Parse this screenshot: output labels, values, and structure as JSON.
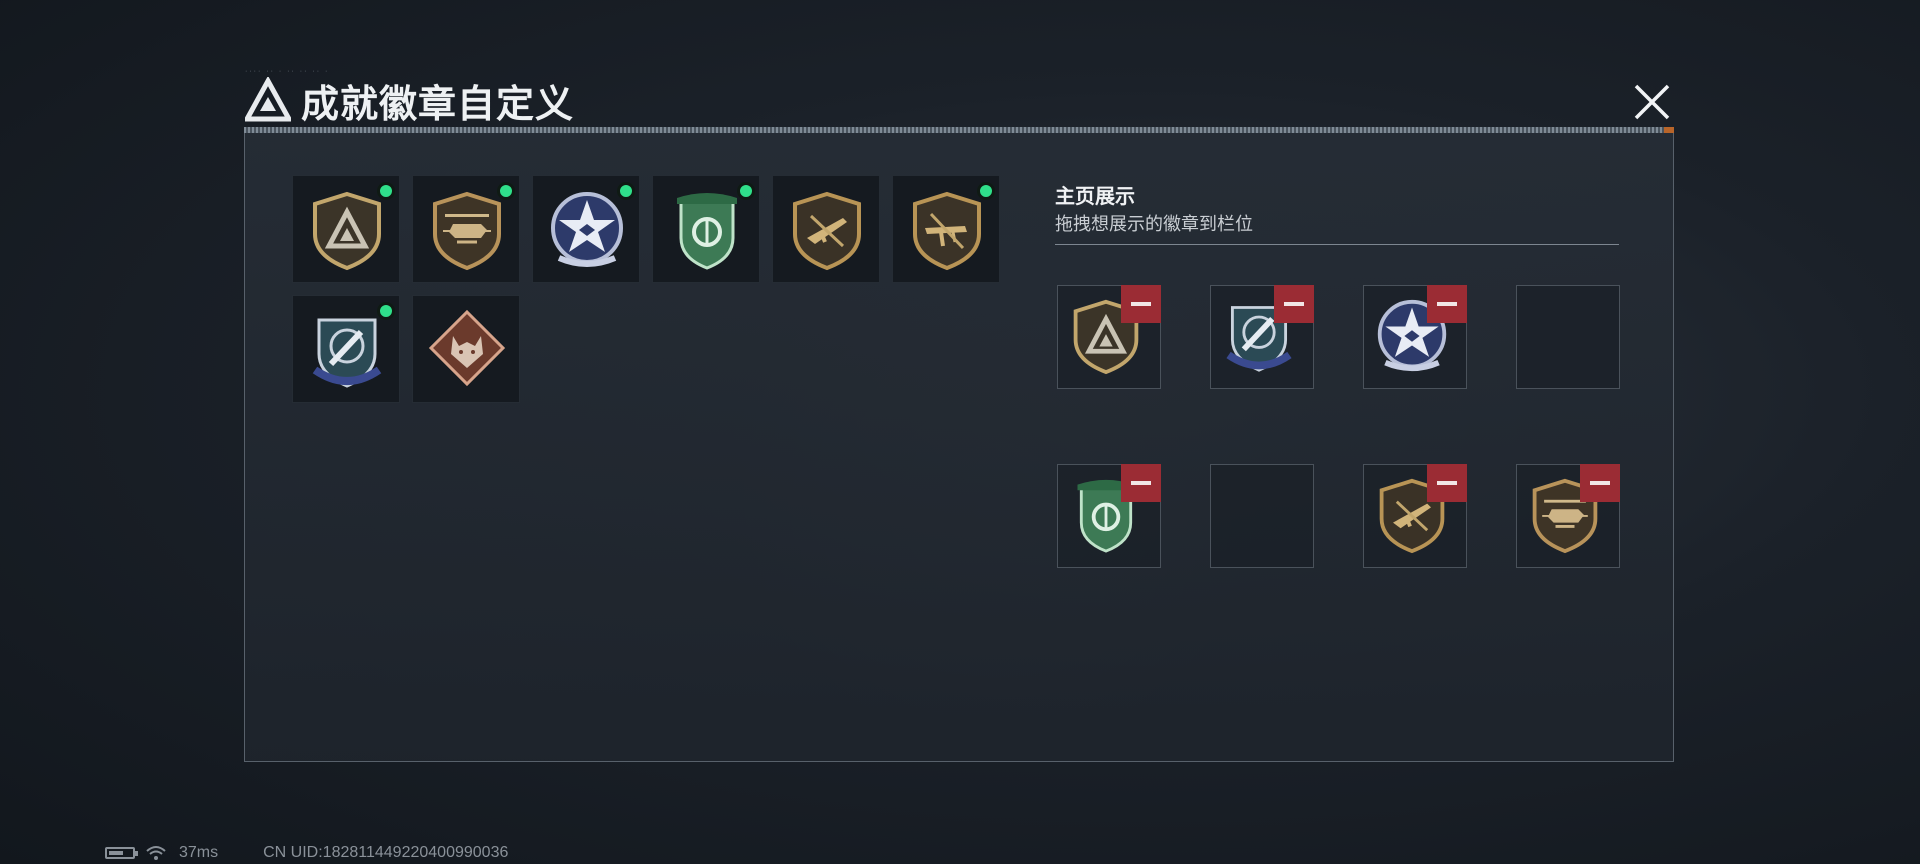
{
  "header": {
    "title": "成就徽章自定义",
    "deco_text": "···· ·· · ·· ·· ·· ·"
  },
  "showcase": {
    "title": "主页展示",
    "subtitle": "拖拽想展示的徽章到栏位"
  },
  "badges": [
    {
      "icon": "triangle-shield-badge",
      "has_dot": true
    },
    {
      "icon": "helicopter-badge",
      "has_dot": true
    },
    {
      "icon": "navy-star-badge",
      "has_dot": true
    },
    {
      "icon": "green-shield-badge",
      "has_dot": true
    },
    {
      "icon": "rifle-badge",
      "has_dot": false
    },
    {
      "icon": "smg-badge",
      "has_dot": true
    },
    {
      "icon": "missile-shield-badge",
      "has_dot": true
    },
    {
      "icon": "wolf-diamond-badge",
      "has_dot": false
    }
  ],
  "slots": [
    {
      "icon": "triangle-shield-badge",
      "filled": true
    },
    {
      "icon": "missile-shield-badge",
      "filled": true
    },
    {
      "icon": "navy-star-badge",
      "filled": true
    },
    {
      "icon": "",
      "filled": false
    },
    {
      "icon": "green-shield-badge",
      "filled": true
    },
    {
      "icon": "",
      "filled": false
    },
    {
      "icon": "rifle-badge",
      "filled": true
    },
    {
      "icon": "helicopter-badge",
      "filled": true
    }
  ],
  "status": {
    "ping": "37ms",
    "uid": "CN UID:1828114492204009900​36"
  },
  "colors": {
    "green_dot": "#2fe08a",
    "remove_red": "#9b2c34",
    "panel_border": "#58616b"
  }
}
